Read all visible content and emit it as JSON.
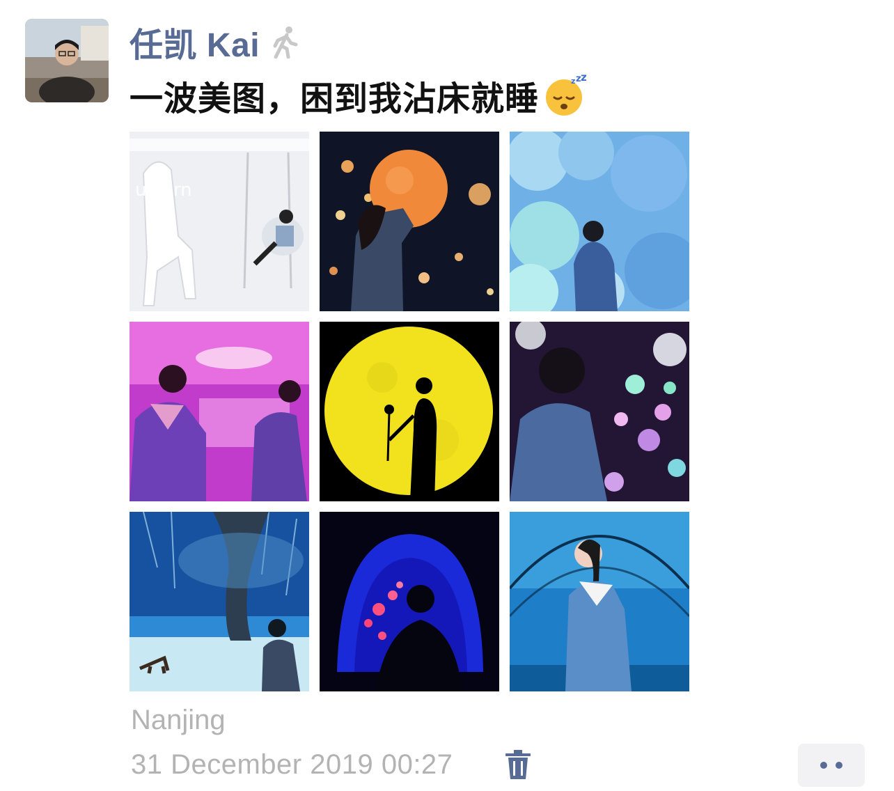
{
  "post": {
    "author": "任凯 Kai",
    "text": "一波美图，困到我沾床就睡",
    "emoji": "😴",
    "location": "Nanjing",
    "timestamp": "31 December 2019 00:27"
  },
  "icons": {
    "author_badge": "walking-person-icon",
    "delete": "trash-icon",
    "more": "more-dots-icon"
  },
  "photos": [
    {
      "scene": "white-unicorn-room"
    },
    {
      "scene": "orange-moon-lamp"
    },
    {
      "scene": "blue-cloud-room"
    },
    {
      "scene": "pink-light-room"
    },
    {
      "scene": "yellow-moon-silhouette"
    },
    {
      "scene": "glowing-jellyfish-room"
    },
    {
      "scene": "blue-forest-tree"
    },
    {
      "scene": "blue-arch-jellyfish"
    },
    {
      "scene": "aquarium-tunnel"
    }
  ],
  "colors": {
    "name": "#576b95",
    "meta": "#b3b3b3",
    "text": "#111111"
  }
}
